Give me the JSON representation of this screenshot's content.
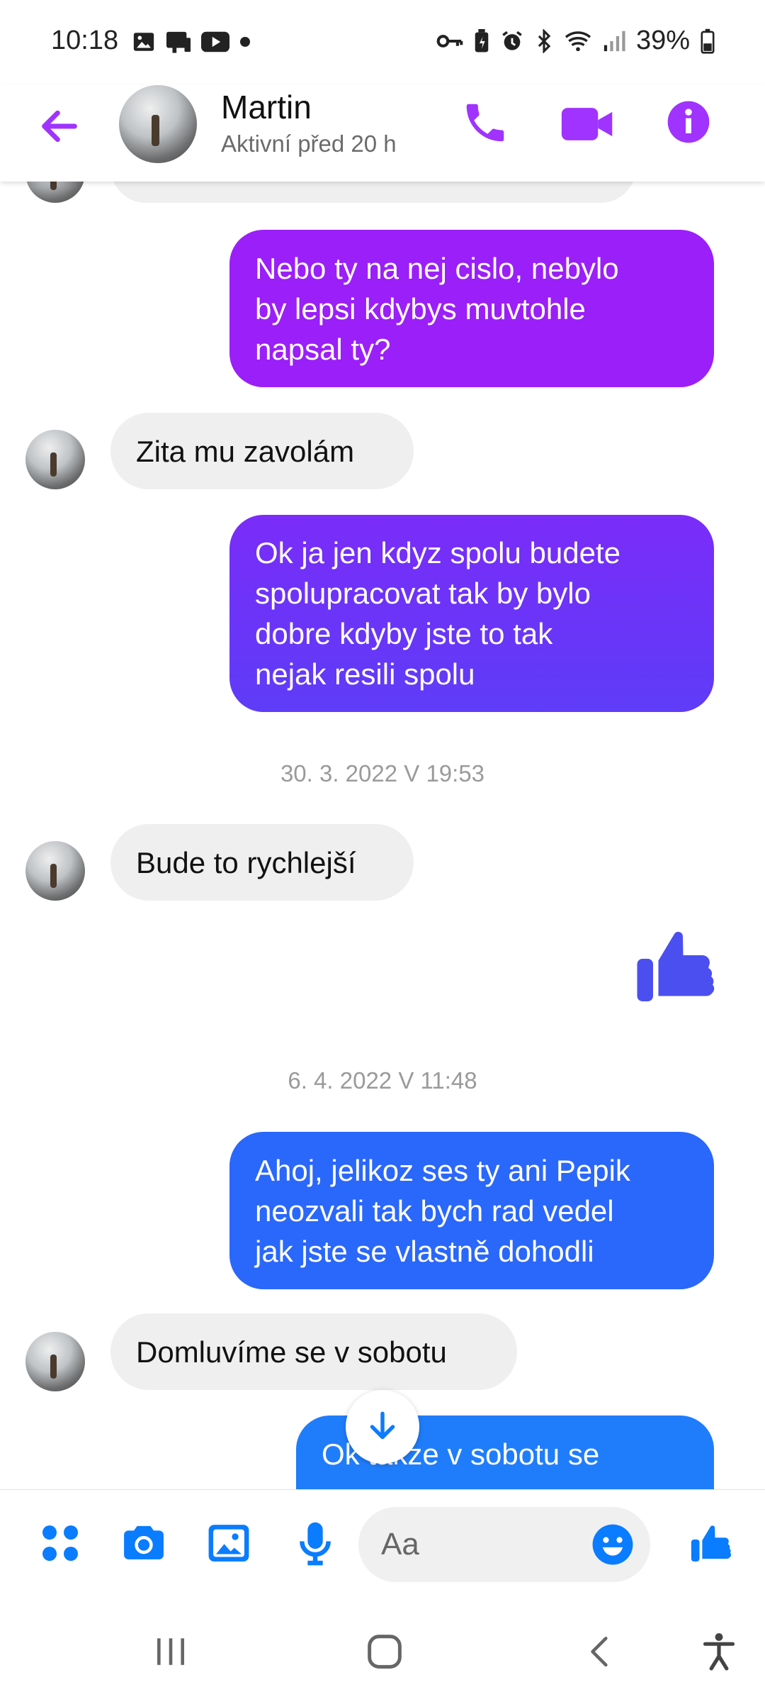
{
  "status_bar": {
    "time": "10:18",
    "battery": "39%",
    "icons": [
      "gallery-icon",
      "media-icon",
      "youtube-icon",
      "dot-icon",
      "key-icon",
      "battery-saver-icon",
      "alarm-icon",
      "bluetooth-icon",
      "wifi-icon",
      "signal-icon",
      "battery-icon"
    ]
  },
  "header": {
    "name": "Martin",
    "status": "Aktivní před 20 h"
  },
  "colors": {
    "accent_purple": "#a033ff",
    "bubble_purple": "#9b1ff8",
    "bubble_violet": "#6a35f7",
    "bubble_blue": "#2570ff",
    "thumb_blue": "#4b4ff0",
    "composer_blue": "#0a7cff"
  },
  "messages": [
    {
      "id": "m0",
      "direction": "in",
      "text": ""
    },
    {
      "id": "m1",
      "direction": "out",
      "text_lines": [
        "Nebo ty na nej cislo, nebylo",
        "by lepsi kdybys muvtohle",
        "napsal ty?"
      ]
    },
    {
      "id": "m2",
      "direction": "in",
      "text": "Zita mu zavolám"
    },
    {
      "id": "m3",
      "direction": "out",
      "text_lines": [
        "Ok ja jen kdyz spolu budete",
        "spolupracovat tak by bylo",
        "dobre kdyby jste to tak",
        "nejak resili spolu"
      ]
    },
    {
      "id": "ts1",
      "type": "timestamp",
      "text": "30. 3. 2022 V 19:53"
    },
    {
      "id": "m4",
      "direction": "in",
      "text": "Bude to rychlejší"
    },
    {
      "id": "m5",
      "direction": "out",
      "type": "like"
    },
    {
      "id": "ts2",
      "type": "timestamp",
      "text": "6. 4. 2022 V 11:48"
    },
    {
      "id": "m6",
      "direction": "out",
      "text_lines": [
        "Ahoj, jelikoz ses ty ani Pepik",
        "neozvali tak bych rad vedel",
        "jak jste se vlastně dohodli"
      ]
    },
    {
      "id": "m7",
      "direction": "in",
      "text": "Domluvíme se v sobotu"
    },
    {
      "id": "m8",
      "direction": "out",
      "text": "Ok takze v sobotu se"
    }
  ],
  "composer": {
    "placeholder": "Aa"
  }
}
